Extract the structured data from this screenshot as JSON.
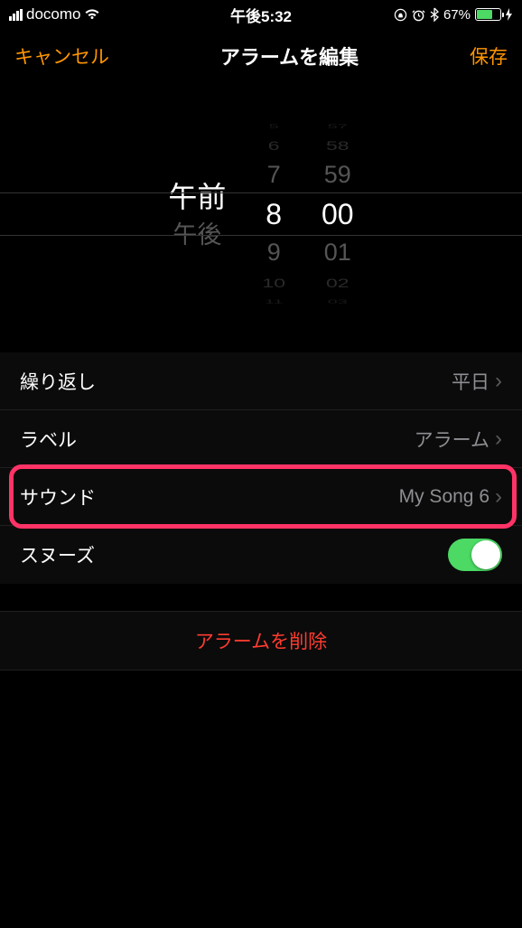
{
  "status": {
    "carrier": "docomo",
    "time": "午後5:32",
    "battery_pct": "67%"
  },
  "nav": {
    "cancel": "キャンセル",
    "title": "アラームを編集",
    "save": "保存"
  },
  "picker": {
    "ampm": {
      "am": "午前",
      "pm": "午後"
    },
    "hours": [
      "5",
      "6",
      "7",
      "8",
      "9",
      "10",
      "11"
    ],
    "minutes": [
      "57",
      "58",
      "59",
      "00",
      "01",
      "02",
      "03"
    ],
    "selected_ampm": "午前",
    "selected_hour": "8",
    "selected_minute": "00"
  },
  "rows": {
    "repeat": {
      "label": "繰り返し",
      "value": "平日"
    },
    "label": {
      "label": "ラベル",
      "value": "アラーム"
    },
    "sound": {
      "label": "サウンド",
      "value": "My Song 6"
    },
    "snooze": {
      "label": "スヌーズ"
    }
  },
  "delete_label": "アラームを削除"
}
